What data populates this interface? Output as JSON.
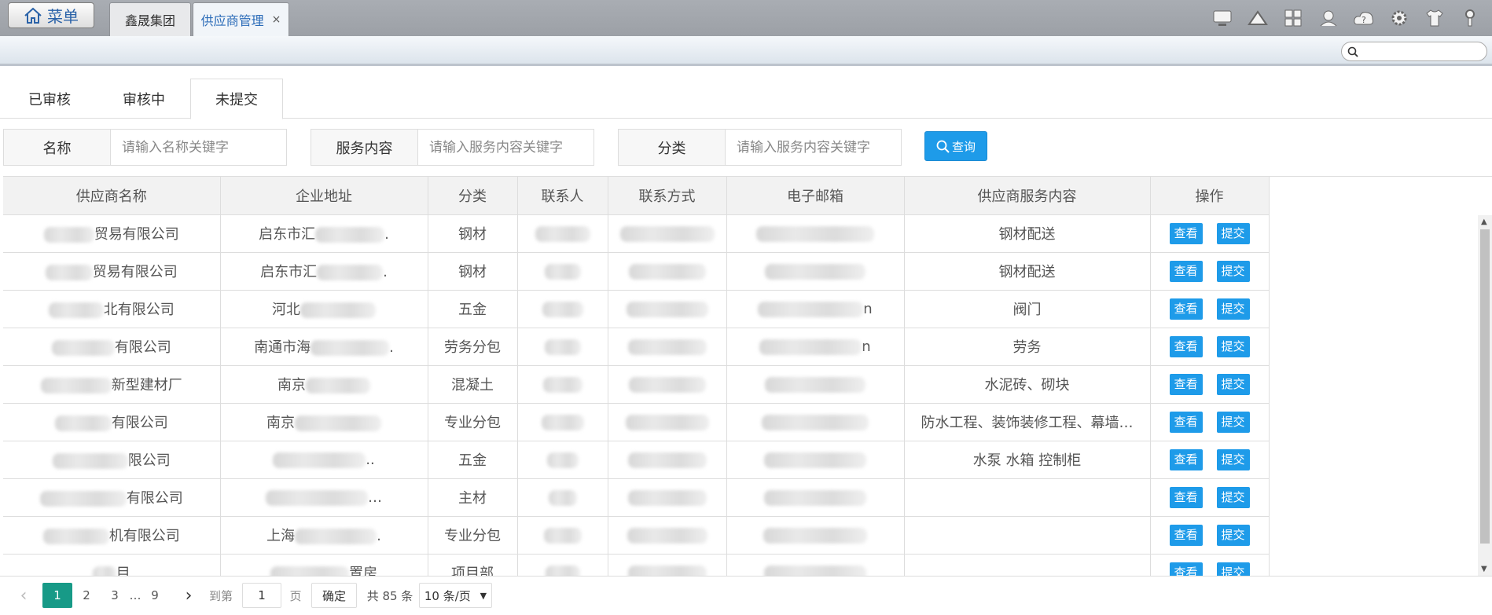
{
  "topbar": {
    "menu_label": "菜单",
    "tabs": [
      {
        "label": "鑫晟集团"
      },
      {
        "label": "供应商管理",
        "close": "×"
      }
    ],
    "icons": [
      "monitor-icon",
      "cloud-service-icon",
      "apps-icon",
      "user-icon",
      "help-cloud-icon",
      "gear-icon",
      "shirt-icon",
      "key-icon"
    ]
  },
  "status_tabs": [
    {
      "label": "已审核"
    },
    {
      "label": "审核中"
    },
    {
      "label": "未提交",
      "active": true
    }
  ],
  "filters": {
    "name": {
      "label": "名称",
      "placeholder": "请输入名称关键字"
    },
    "service": {
      "label": "服务内容",
      "placeholder": "请输入服务内容关键字"
    },
    "category": {
      "label": "分类",
      "placeholder": "请输入服务内容关键字"
    },
    "query_label": "查询"
  },
  "table": {
    "columns": [
      "供应商名称",
      "企业地址",
      "分类",
      "联系人",
      "联系方式",
      "电子邮箱",
      "供应商服务内容",
      "操作"
    ],
    "view_label": "查看",
    "submit_label": "提交",
    "rows": [
      {
        "name": "贸易有限公司",
        "address": "启东市汇",
        "address_suffix": ".",
        "category": "钢材",
        "email_suffix": "",
        "service": "钢材配送"
      },
      {
        "name": "贸易有限公司",
        "address": "启东市汇",
        "address_suffix": ".",
        "category": "钢材",
        "email_suffix": "",
        "service": "钢材配送"
      },
      {
        "name": "北有限公司",
        "address": "河北",
        "address_suffix": "",
        "category": "五金",
        "email_suffix": "n",
        "service": "阀门"
      },
      {
        "name": "有限公司",
        "address": "南通市海",
        "address_suffix": ".",
        "category": "劳务分包",
        "email_suffix": "n",
        "service": "劳务"
      },
      {
        "name": "新型建材厂",
        "address": "南京",
        "address_suffix": "",
        "category": "混凝土",
        "email_suffix": "",
        "service": "水泥砖、砌块"
      },
      {
        "name": "有限公司",
        "address": "南京",
        "address_suffix": "",
        "category": "专业分包",
        "email_suffix": "",
        "service": "防水工程、装饰装修工程、幕墙…"
      },
      {
        "name": "限公司",
        "address": "",
        "address_suffix": "..",
        "category": "五金",
        "email_suffix": "",
        "service": "水泵 水箱 控制柜"
      },
      {
        "name": "有限公司",
        "address": "",
        "address_suffix": "…",
        "category": "主材",
        "email_suffix": "",
        "service": ""
      },
      {
        "name": "机有限公司",
        "address": "上海",
        "address_suffix": ".",
        "category": "专业分包",
        "email_suffix": "",
        "service": ""
      },
      {
        "name": "目",
        "address": "",
        "address_suffix": "置房",
        "category": "项目部",
        "email_suffix": "",
        "service": ""
      }
    ]
  },
  "pager": {
    "prev": "‹",
    "pages": [
      "1",
      "2",
      "3",
      "9"
    ],
    "ellipsis": "…",
    "next": "›",
    "goto_label": "到第",
    "goto_value": "1",
    "page_label": "页",
    "confirm_label": "确定",
    "total_label": "共 85 条",
    "page_size": "10 条/页",
    "page_size_arrow": "▼"
  },
  "colors": {
    "accent": "#1e9be9",
    "pager_active": "#179a87",
    "tab_active_text": "#2a6bb8"
  }
}
